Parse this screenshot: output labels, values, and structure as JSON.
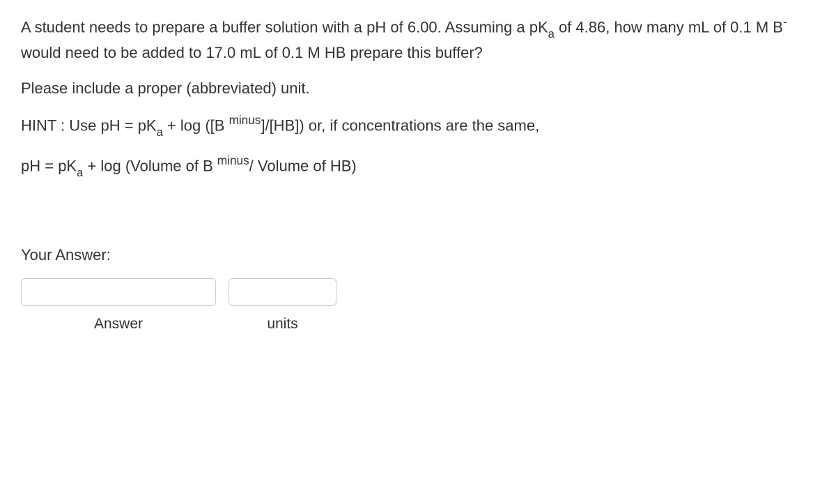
{
  "question": {
    "line1_a": "A student needs to prepare a buffer solution with a pH of 6.00. Assuming a pK",
    "line1_sub": "a",
    "line1_b": " of",
    "line2_a": "4.86, how many mL of 0.1 M B",
    "line2_sup": "-",
    "line2_b": " would need to be added to 17.0 mL of 0.1 M HB prepare this buffer?",
    "line3": "Please include a proper (abbreviated) unit.",
    "hint1_a": "HINT : Use pH = pK",
    "hint1_sub": "a",
    "hint1_b": " + log ([B ",
    "hint1_sup": "minus",
    "hint1_c": "]/[HB]) or, if concentrations are the same,",
    "hint2_a": "pH = pK",
    "hint2_sub": "a",
    "hint2_b": " + log (Volume of B ",
    "hint2_sup": "minus",
    "hint2_c": "/ Volume of HB)"
  },
  "answer_section": {
    "label": "Your Answer:",
    "answer_caption": "Answer",
    "units_caption": "units",
    "answer_value": "",
    "units_value": ""
  }
}
